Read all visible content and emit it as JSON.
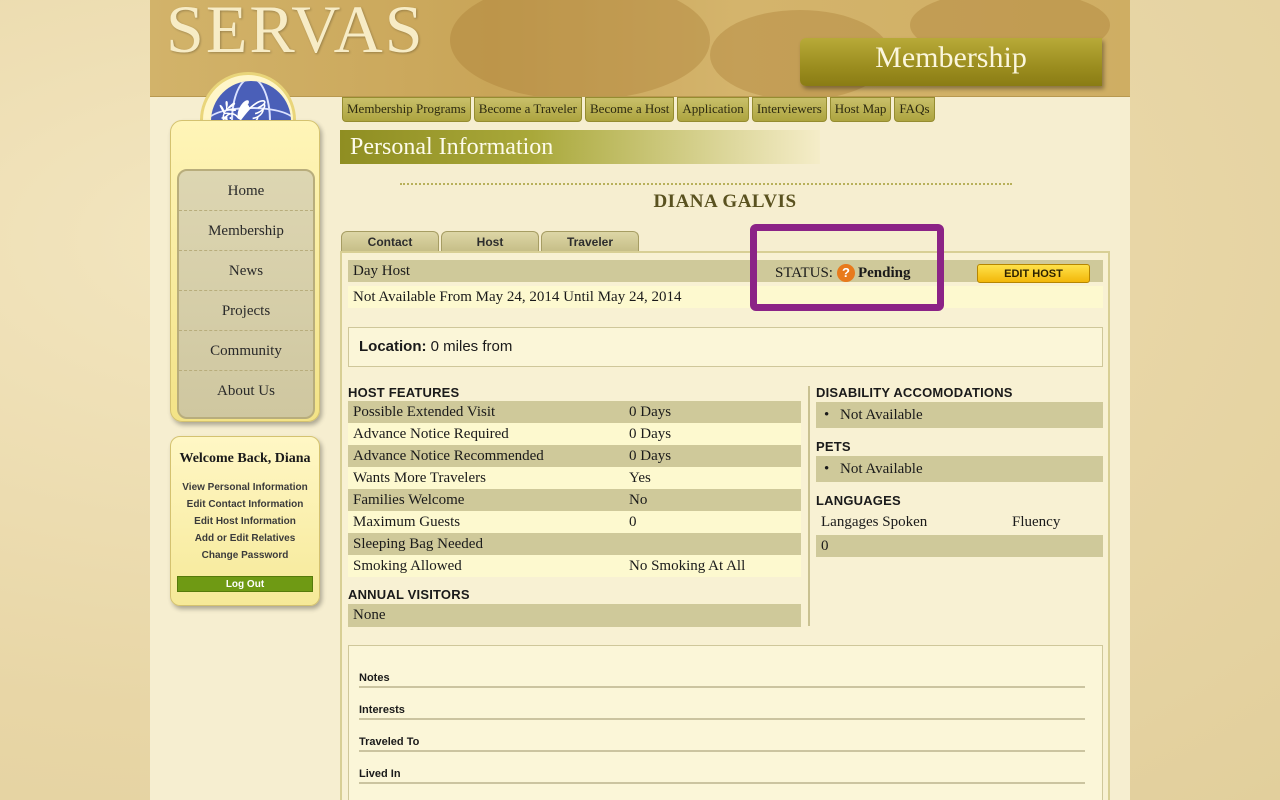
{
  "site": {
    "logo": "SERVAS",
    "section_banner": "Membership"
  },
  "top_nav": [
    "Membership Programs",
    "Become a Traveler",
    "Become a Host",
    "Application",
    "Interviewers",
    "Host Map",
    "FAQs"
  ],
  "side_nav": [
    "Home",
    "Membership",
    "News",
    "Projects",
    "Community",
    "About Us"
  ],
  "welcome": {
    "title": "Welcome Back, Diana",
    "links": [
      "View Personal Information",
      "Edit Contact Information",
      "Edit Host Information",
      "Add or Edit Relatives",
      "Change Password"
    ],
    "logout": "Log Out"
  },
  "page_title": "Personal Information",
  "person_name": "DIANA GALVIS",
  "tabs": [
    "Contact",
    "Host",
    "Traveler"
  ],
  "host": {
    "type": "Day Host",
    "status_label": "STATUS:",
    "status_value": "Pending",
    "status_icon": "?",
    "edit_button": "EDIT HOST",
    "availability": "Not Available From May 24, 2014 Until May 24, 2014"
  },
  "location": {
    "label": "Location:",
    "value": "0 miles from"
  },
  "host_features": {
    "heading": "HOST FEATURES",
    "rows": [
      {
        "label": "Possible Extended Visit",
        "value": "0 Days"
      },
      {
        "label": "Advance Notice Required",
        "value": "0 Days"
      },
      {
        "label": "Advance Notice Recommended",
        "value": "0 Days"
      },
      {
        "label": "Wants More Travelers",
        "value": "Yes"
      },
      {
        "label": "Families Welcome",
        "value": "No"
      },
      {
        "label": "Maximum Guests",
        "value": "0"
      },
      {
        "label": "Sleeping Bag Needed",
        "value": ""
      },
      {
        "label": "Smoking Allowed",
        "value": "No Smoking At All"
      }
    ]
  },
  "annual_visitors": {
    "heading": "ANNUAL VISITORS",
    "value": "None"
  },
  "disability": {
    "heading": "DISABILITY ACCOMODATIONS",
    "value": "Not Available"
  },
  "pets": {
    "heading": "PETS",
    "value": "Not Available"
  },
  "languages": {
    "heading": "LANGUAGES",
    "col1": "Langages Spoken",
    "col2": "Fluency",
    "value": "0"
  },
  "notes_sections": [
    "Notes",
    "Interests",
    "Traveled To",
    "Lived In"
  ],
  "colors": {
    "highlight": "#8b2386",
    "status_icon": "#e87a1c",
    "logout": "#6f9a14"
  }
}
